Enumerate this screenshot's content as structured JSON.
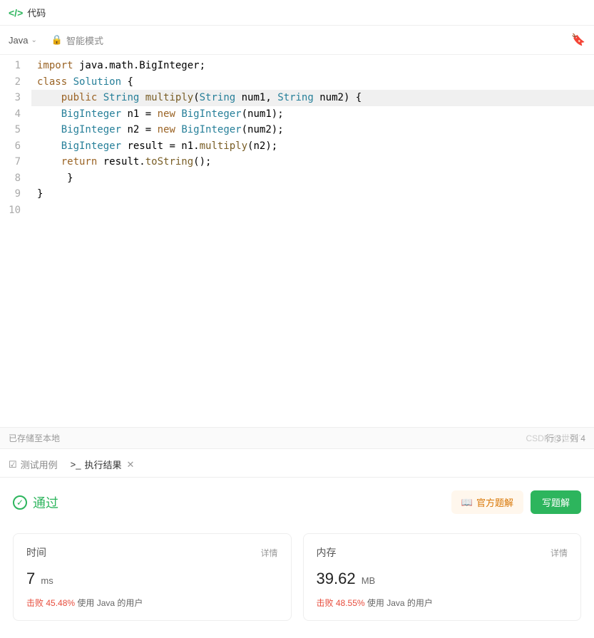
{
  "header": {
    "title": "代码"
  },
  "toolbar": {
    "language": "Java",
    "mode": "智能模式"
  },
  "code": {
    "lines": [
      {
        "n": 1,
        "t": [
          [
            "kw",
            "import"
          ],
          [
            "",
            " java.math.BigInteger;"
          ]
        ]
      },
      {
        "n": 2,
        "t": [
          [
            "kw",
            "class"
          ],
          [
            "",
            " "
          ],
          [
            "cls",
            "Solution"
          ],
          [
            "",
            " {"
          ]
        ]
      },
      {
        "n": 3,
        "hl": true,
        "t": [
          [
            "",
            "    "
          ],
          [
            "kw",
            "public"
          ],
          [
            "",
            " "
          ],
          [
            "type",
            "String"
          ],
          [
            "",
            " "
          ],
          [
            "fn",
            "multiply"
          ],
          [
            "",
            "("
          ],
          [
            "type",
            "String"
          ],
          [
            "",
            " num1, "
          ],
          [
            "type",
            "String"
          ],
          [
            "",
            " num2) {"
          ]
        ]
      },
      {
        "n": 4,
        "t": [
          [
            "",
            "    "
          ],
          [
            "type",
            "BigInteger"
          ],
          [
            "",
            " n1 = "
          ],
          [
            "new",
            "new"
          ],
          [
            "",
            " "
          ],
          [
            "type",
            "BigInteger"
          ],
          [
            "",
            "(num1);"
          ]
        ]
      },
      {
        "n": 5,
        "t": [
          [
            "",
            "    "
          ],
          [
            "type",
            "BigInteger"
          ],
          [
            "",
            " n2 = "
          ],
          [
            "new",
            "new"
          ],
          [
            "",
            " "
          ],
          [
            "type",
            "BigInteger"
          ],
          [
            "",
            "(num2);"
          ]
        ]
      },
      {
        "n": 6,
        "t": [
          [
            "",
            "    "
          ],
          [
            "type",
            "BigInteger"
          ],
          [
            "",
            " result = n1."
          ],
          [
            "fn",
            "multiply"
          ],
          [
            "",
            "(n2);"
          ]
        ]
      },
      {
        "n": 7,
        "t": [
          [
            "",
            ""
          ]
        ]
      },
      {
        "n": 8,
        "t": [
          [
            "",
            "    "
          ],
          [
            "kw",
            "return"
          ],
          [
            "",
            " result."
          ],
          [
            "fn",
            "toString"
          ],
          [
            "",
            "();"
          ]
        ]
      },
      {
        "n": 9,
        "t": [
          [
            "",
            "     }"
          ]
        ]
      },
      {
        "n": 10,
        "t": [
          [
            "",
            "}"
          ]
        ]
      }
    ]
  },
  "status": {
    "saved": "已存储至本地",
    "cursor": "行 3，列 4"
  },
  "tabs": {
    "testcase": "测试用例",
    "result": "执行结果"
  },
  "result": {
    "pass": "通过",
    "official": "官方题解",
    "write": "写题解",
    "detail": "详情",
    "time": {
      "label": "时间",
      "value": "7",
      "unit": "ms",
      "beat_prefix": "击败",
      "pct": "45.48%",
      "suffix": " 使用 Java 的用户"
    },
    "memory": {
      "label": "内存",
      "value": "39.62",
      "unit": "MB",
      "beat_prefix": "击败",
      "pct": "48.55%",
      "suffix": " 使用 Java 的用户"
    }
  },
  "watermark": "CSDN @世俗ˊ"
}
